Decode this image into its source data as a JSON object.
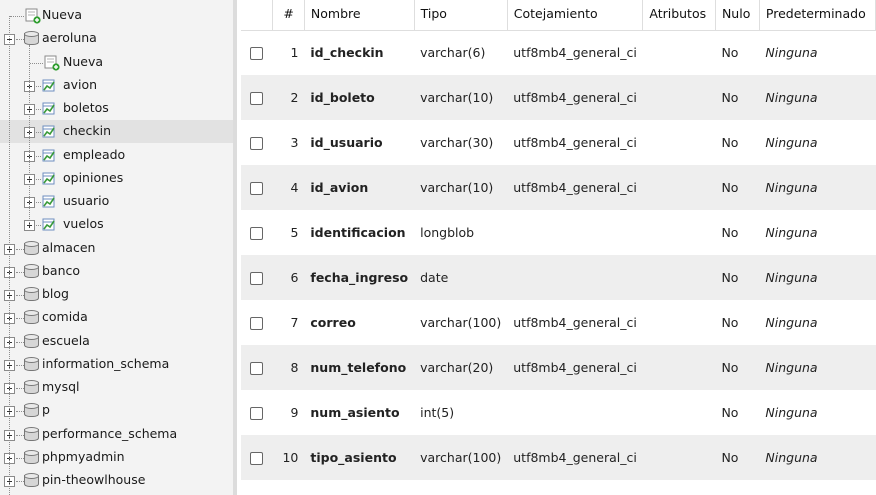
{
  "navigation": {
    "top_item": {
      "label": "Nueva",
      "icon": "new-icon"
    },
    "expanded_database": {
      "label": "aeroluna",
      "icon": "database-icon",
      "new_item": {
        "label": "Nueva",
        "icon": "new-table-icon"
      },
      "tables": [
        {
          "label": "avion"
        },
        {
          "label": "boletos"
        },
        {
          "label": "checkin",
          "selected": true
        },
        {
          "label": "empleado"
        },
        {
          "label": "opiniones"
        },
        {
          "label": "usuario"
        },
        {
          "label": "vuelos"
        }
      ]
    },
    "databases": [
      {
        "label": "almacen"
      },
      {
        "label": "banco"
      },
      {
        "label": "blog"
      },
      {
        "label": "comida"
      },
      {
        "label": "escuela"
      },
      {
        "label": "information_schema"
      },
      {
        "label": "mysql"
      },
      {
        "label": "p"
      },
      {
        "label": "performance_schema"
      },
      {
        "label": "phpmyadmin"
      },
      {
        "label": "pin-theowlhouse"
      }
    ]
  },
  "structure_table": {
    "headers": {
      "number": "#",
      "name": "Nombre",
      "type": "Tipo",
      "collation": "Cotejamiento",
      "attributes": "Atributos",
      "null": "Nulo",
      "default": "Predeterminado"
    },
    "rows": [
      {
        "num": "1",
        "name": "id_checkin",
        "type": "varchar(6)",
        "collation": "utf8mb4_general_ci",
        "attributes": "",
        "null": "No",
        "default": "Ninguna"
      },
      {
        "num": "2",
        "name": "id_boleto",
        "type": "varchar(10)",
        "collation": "utf8mb4_general_ci",
        "attributes": "",
        "null": "No",
        "default": "Ninguna"
      },
      {
        "num": "3",
        "name": "id_usuario",
        "type": "varchar(30)",
        "collation": "utf8mb4_general_ci",
        "attributes": "",
        "null": "No",
        "default": "Ninguna"
      },
      {
        "num": "4",
        "name": "id_avion",
        "type": "varchar(10)",
        "collation": "utf8mb4_general_ci",
        "attributes": "",
        "null": "No",
        "default": "Ninguna"
      },
      {
        "num": "5",
        "name": "identificacion",
        "type": "longblob",
        "collation": "",
        "attributes": "",
        "null": "No",
        "default": "Ninguna"
      },
      {
        "num": "6",
        "name": "fecha_ingreso",
        "type": "date",
        "collation": "",
        "attributes": "",
        "null": "No",
        "default": "Ninguna"
      },
      {
        "num": "7",
        "name": "correo",
        "type": "varchar(100)",
        "collation": "utf8mb4_general_ci",
        "attributes": "",
        "null": "No",
        "default": "Ninguna"
      },
      {
        "num": "8",
        "name": "num_telefono",
        "type": "varchar(20)",
        "collation": "utf8mb4_general_ci",
        "attributes": "",
        "null": "No",
        "default": "Ninguna"
      },
      {
        "num": "9",
        "name": "num_asiento",
        "type": "int(5)",
        "collation": "",
        "attributes": "",
        "null": "No",
        "default": "Ninguna"
      },
      {
        "num": "10",
        "name": "tipo_asiento",
        "type": "varchar(100)",
        "collation": "utf8mb4_general_ci",
        "attributes": "",
        "null": "No",
        "default": "Ninguna"
      }
    ]
  },
  "colors": {
    "sidebar_bg": "#f3f3f3",
    "row_alt": "#eeeeee",
    "selected_bg": "#e2e2e2",
    "table_icon_green": "#3a9a3a"
  }
}
